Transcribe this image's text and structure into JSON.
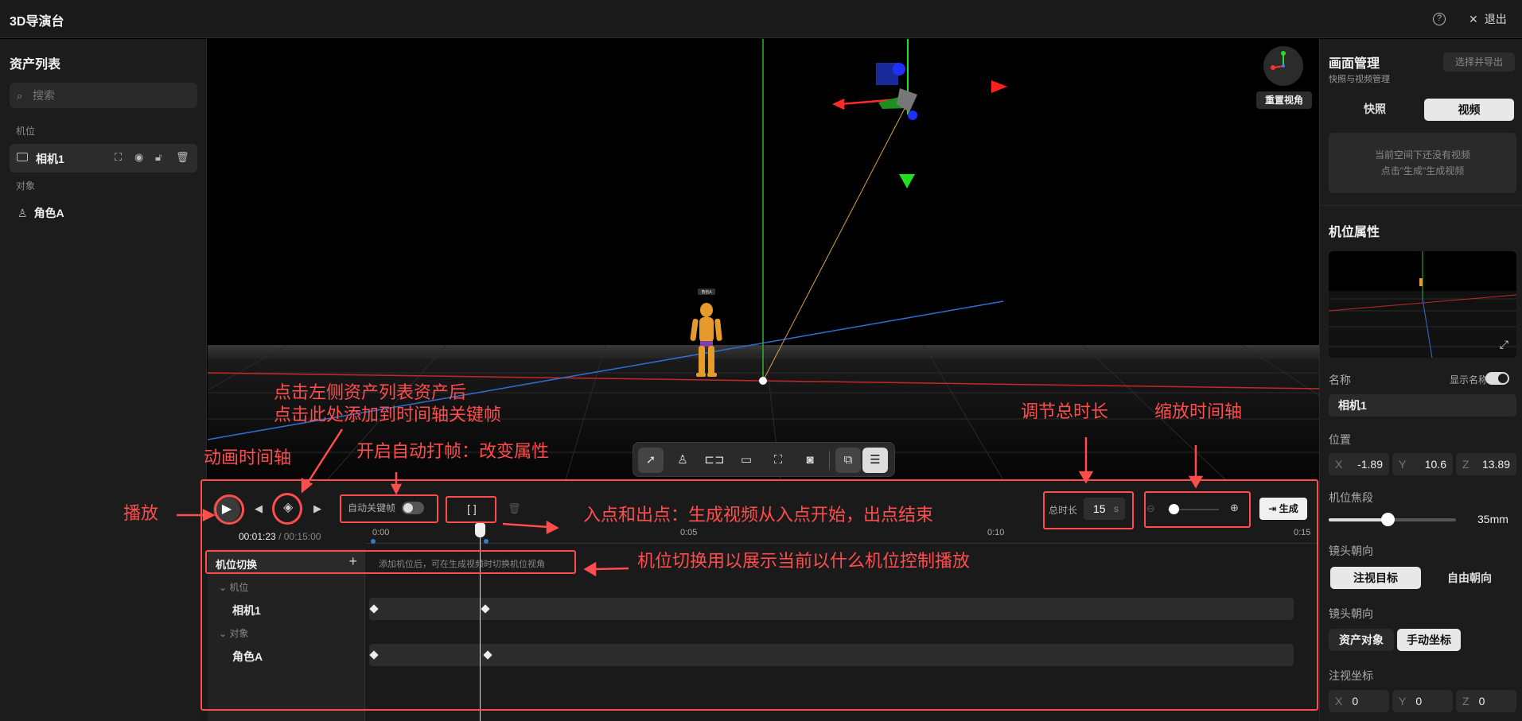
{
  "app": {
    "title": "3D导演台",
    "help_icon": "?",
    "exit_label": "退出"
  },
  "assets": {
    "title": "资产列表",
    "search_placeholder": "搜索",
    "group_camera": "机位",
    "camera_item": "相机1",
    "group_object": "对象",
    "object_item": "角色A"
  },
  "viewport": {
    "reset_view_label": "重置视角",
    "character_tag": "角色A"
  },
  "timeline": {
    "auto_key_label": "自动关键帧",
    "in_out_label": "[     ]",
    "total_label": "总时长",
    "total_value": "15",
    "total_unit": "s",
    "generate_label": "生成",
    "current_time": "00:01:23",
    "separator": "/",
    "total_time": "00:15:00",
    "ticks": [
      "0:00",
      "0:05",
      "0:10",
      "0:15"
    ],
    "camera_switch_title": "机位切换",
    "camera_switch_hint": "添加机位后，可在生成视频时切换机位视角",
    "group_camera": "机位",
    "track_camera": "相机1",
    "group_object": "对象",
    "track_object": "角色A",
    "zoom_value": 0.05
  },
  "panel": {
    "title": "画面管理",
    "subtitle": "快照与视频管理",
    "export_label": "选择并导出",
    "tab_snapshot": "快照",
    "tab_video": "视频",
    "empty_line1": "当前空间下还没有视频",
    "empty_line2": "点击\"生成\"生成视频",
    "camera_props_title": "机位属性",
    "name_label": "名称",
    "show_name_label": "显示名称",
    "name_value": "相机1",
    "position_label": "位置",
    "pos_x": "-1.89",
    "pos_y": "10.6",
    "pos_z": "13.89",
    "focal_label": "机位焦段",
    "focal_value": "35mm",
    "focal_fraction": 0.46,
    "orient_label": "镜头朝向",
    "orient_look": "注视目标",
    "orient_free": "自由朝向",
    "orient2_label": "镜头朝向",
    "orient2_asset": "资产对象",
    "orient2_manual": "手动坐标",
    "look_coord_label": "注视坐标",
    "look_x": "0",
    "look_y": "0",
    "look_z": "0",
    "axis_x": "X",
    "axis_y": "Y",
    "axis_z": "Z"
  },
  "annotations": {
    "click_asset_1": "点击左侧资产列表资产后",
    "click_asset_2": "点击此处添加到时间轴关键帧",
    "auto_key": "开启自动打帧：改变属性",
    "anim_timeline": "动画时间轴",
    "play": "播放",
    "in_out": "入点和出点：生成视频从入点开始，出点结束",
    "adjust_total": "调节总时长",
    "zoom_timeline": "缩放时间轴",
    "camera_switch": "机位切换用以展示当前以什么机位控制播放"
  },
  "colors": {
    "accent": "#ff4d4d",
    "panel": "#1c1c1c",
    "bg": "#000000"
  }
}
